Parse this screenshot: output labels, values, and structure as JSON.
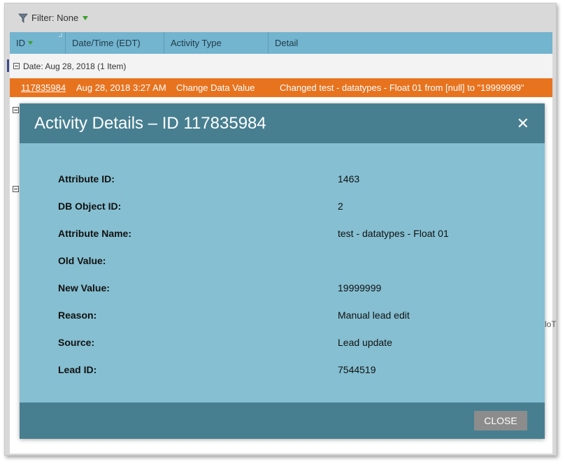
{
  "filter": {
    "label": "Filter: None"
  },
  "table": {
    "columns": [
      "ID",
      "Date/Time (EDT)",
      "Activity Type",
      "Detail"
    ],
    "group": {
      "label": "Date: Aug 28, 2018 (1 Item)"
    },
    "row": {
      "id": "117835984",
      "datetime": "Aug 28, 2018 3:27 AM",
      "activity_type": "Change Data Value",
      "detail": "Changed test - datatypes - Float 01 from [null] to \"19999999\""
    },
    "background_fragment": "loT"
  },
  "modal": {
    "title": "Activity Details – ID 117835984",
    "close_icon": "close-icon",
    "fields": [
      {
        "label": "Attribute ID:",
        "value": "1463"
      },
      {
        "label": "DB Object ID:",
        "value": "2"
      },
      {
        "label": "Attribute Name:",
        "value": "test - datatypes - Float 01"
      },
      {
        "label": "Old Value:",
        "value": ""
      },
      {
        "label": "New Value:",
        "value": "19999999"
      },
      {
        "label": "Reason:",
        "value": "Manual lead edit"
      },
      {
        "label": "Source:",
        "value": "Lead update"
      },
      {
        "label": "Lead ID:",
        "value": "7544519"
      }
    ],
    "close_button_label": "CLOSE"
  },
  "colors": {
    "header_blue": "#73b4cf",
    "highlight_orange": "#e8731f",
    "modal_body": "#85bfd1",
    "modal_bar": "#477f91",
    "button_gray": "#8c8c8c"
  }
}
